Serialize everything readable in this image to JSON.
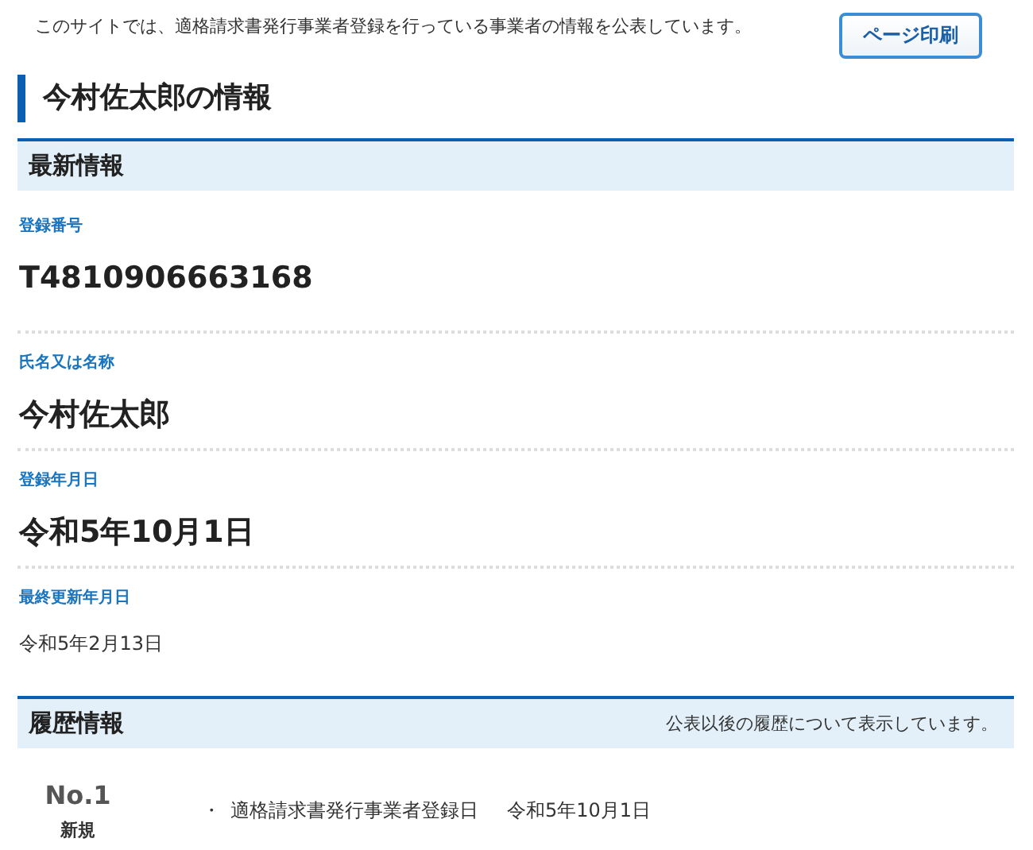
{
  "intro": "このサイトでは、適格請求書発行事業者登録を行っている事業者の情報を公表しています。",
  "print_button": "ページ印刷",
  "title": "今村佐太郎の情報",
  "latest": {
    "heading": "最新情報",
    "fields": [
      {
        "label": "登録番号",
        "value": "T4810906663168",
        "kind": "primary"
      },
      {
        "label": "氏名又は名称",
        "value": "今村佐太郎",
        "kind": "primary"
      },
      {
        "label": "登録年月日",
        "value": "令和5年10月1日",
        "kind": "primary"
      },
      {
        "label": "最終更新年月日",
        "value": "令和5年2月13日",
        "kind": "secondary"
      }
    ]
  },
  "history": {
    "heading": "履歴情報",
    "note": "公表以後の履歴について表示しています。",
    "entries": [
      {
        "number": "No.1",
        "type": "新規",
        "bullet": "・",
        "label": "適格請求書発行事業者登録日",
        "date": "令和5年10月1日"
      }
    ]
  }
}
